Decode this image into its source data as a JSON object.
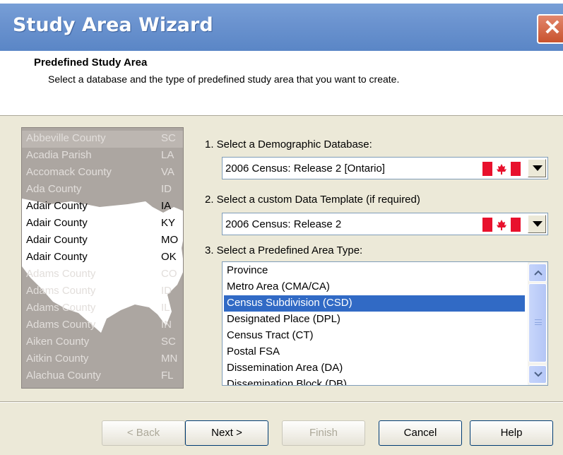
{
  "window": {
    "title": "Study Area Wizard",
    "close_glyph": "✕"
  },
  "header": {
    "title": "Predefined Study Area",
    "subtitle": "Select a database and the type of predefined study area that you want to create."
  },
  "counties": [
    {
      "name": "Abbeville County",
      "state": "SC"
    },
    {
      "name": "Acadia Parish",
      "state": "LA"
    },
    {
      "name": "Accomack County",
      "state": "VA"
    },
    {
      "name": "Ada County",
      "state": "ID"
    },
    {
      "name": "Adair County",
      "state": "IA"
    },
    {
      "name": "Adair County",
      "state": "KY"
    },
    {
      "name": "Adair County",
      "state": "MO"
    },
    {
      "name": "Adair County",
      "state": "OK"
    },
    {
      "name": "Adams County",
      "state": "CO"
    },
    {
      "name": "Adams County",
      "state": "ID"
    },
    {
      "name": "Adams County",
      "state": "IL"
    },
    {
      "name": "Adams County",
      "state": "IN"
    },
    {
      "name": "Aiken County",
      "state": "SC"
    },
    {
      "name": "Aitkin County",
      "state": "MN"
    },
    {
      "name": "Alachua County",
      "state": "FL"
    }
  ],
  "steps": {
    "database_label": "1.  Select a Demographic Database:",
    "database_value": "2006 Census:  Release 2 [Ontario]",
    "template_label": "2.  Select a custom Data Template (if required)",
    "template_value": "2006 Census:  Release 2",
    "area_label": "3.  Select a Predefined Area Type:"
  },
  "area_types": [
    "Province",
    "Metro Area (CMA/CA)",
    "Census Subdivision (CSD)",
    "Designated Place (DPL)",
    "Census Tract (CT)",
    "Postal FSA",
    "Dissemination Area (DA)",
    "Dissemination Block (DB)"
  ],
  "selected_area_type": "Census Subdivision (CSD)",
  "buttons": {
    "back": "< Back",
    "next": "Next >",
    "finish": "Finish",
    "cancel": "Cancel",
    "help": "Help"
  },
  "icons": {
    "flag": "canada-flag-icon",
    "dropdown": "chevron-down-icon",
    "scroll_up": "scroll-up-icon",
    "scroll_down": "scroll-down-icon"
  },
  "colors": {
    "title_bar": "#6b93cf",
    "selection": "#316ac5",
    "flag_red": "#e8112d"
  }
}
